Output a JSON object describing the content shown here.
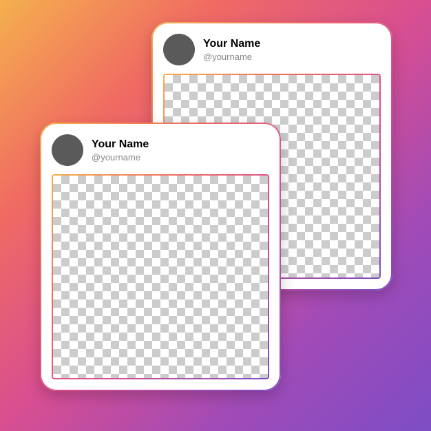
{
  "cards": [
    {
      "display_name": "Your Name",
      "handle": "@yourname"
    },
    {
      "display_name": "Your Name",
      "handle": "@yourname"
    }
  ]
}
